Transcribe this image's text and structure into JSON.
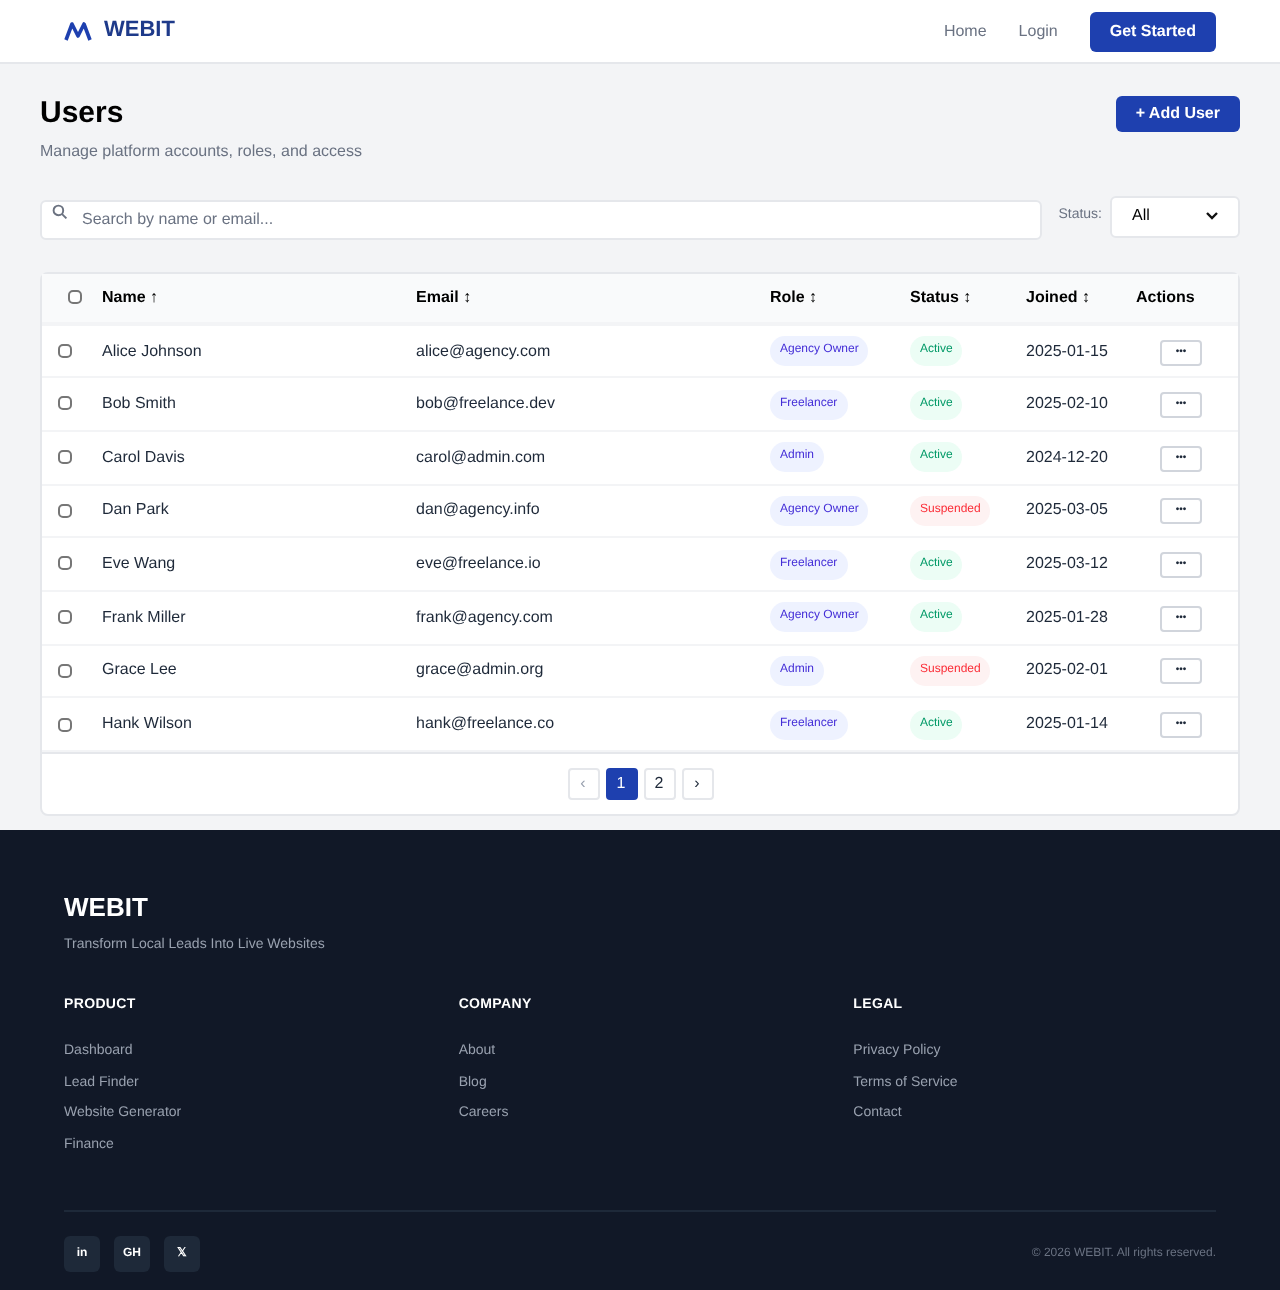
{
  "header": {
    "brand": "WEBIT",
    "nav": [
      "Home",
      "Login"
    ],
    "cta": "Get Started"
  },
  "page": {
    "title": "Users",
    "subtitle": "Manage platform accounts, roles, and access",
    "add_button": "+ Add User"
  },
  "filters": {
    "search_placeholder": "Search by name or email...",
    "status_label": "Status:",
    "status_value": "All"
  },
  "table": {
    "select_all_checked": false,
    "columns": [
      "Name ↑",
      "Email ↕",
      "Role ↕",
      "Status ↕",
      "Joined ↕",
      "Actions"
    ],
    "rows": [
      {
        "checked": false,
        "name": "Alice Johnson",
        "email": "alice@agency.com",
        "role": "Agency Owner",
        "status": "Active",
        "suspended": false,
        "joined": "2025-01-15",
        "action": "•••"
      },
      {
        "checked": false,
        "name": "Bob Smith",
        "email": "bob@freelance.dev",
        "role": "Freelancer",
        "status": "Active",
        "suspended": false,
        "joined": "2025-02-10",
        "action": "•••"
      },
      {
        "checked": false,
        "name": "Carol Davis",
        "email": "carol@admin.com",
        "role": "Admin",
        "status": "Active",
        "suspended": false,
        "joined": "2024-12-20",
        "action": "•••"
      },
      {
        "checked": false,
        "name": "Dan Park",
        "email": "dan@agency.info",
        "role": "Agency Owner",
        "status": "Suspended",
        "suspended": true,
        "joined": "2025-03-05",
        "action": "•••"
      },
      {
        "checked": false,
        "name": "Eve Wang",
        "email": "eve@freelance.io",
        "role": "Freelancer",
        "status": "Active",
        "suspended": false,
        "joined": "2025-03-12",
        "action": "•••"
      },
      {
        "checked": false,
        "name": "Frank Miller",
        "email": "frank@agency.com",
        "role": "Agency Owner",
        "status": "Active",
        "suspended": false,
        "joined": "2025-01-28",
        "action": "•••"
      },
      {
        "checked": false,
        "name": "Grace Lee",
        "email": "grace@admin.org",
        "role": "Admin",
        "status": "Suspended",
        "suspended": true,
        "joined": "2025-02-01",
        "action": "•••"
      },
      {
        "checked": false,
        "name": "Hank Wilson",
        "email": "hank@freelance.co",
        "role": "Freelancer",
        "status": "Active",
        "suspended": false,
        "joined": "2025-01-14",
        "action": "•••"
      }
    ]
  },
  "pagination": [
    {
      "label": "‹",
      "selected": false,
      "disabled": true
    },
    {
      "label": "1",
      "selected": true,
      "disabled": false
    },
    {
      "label": "2",
      "selected": false,
      "disabled": false
    },
    {
      "label": "›",
      "selected": false,
      "disabled": false
    }
  ],
  "footer": {
    "brand": "WEBIT",
    "tagline": "Transform Local Leads Into Live Websites",
    "columns": [
      {
        "heading": "PRODUCT",
        "links": [
          "Dashboard",
          "Lead Finder",
          "Website Generator",
          "Finance"
        ]
      },
      {
        "heading": "COMPANY",
        "links": [
          "About",
          "Blog",
          "Careers"
        ]
      },
      {
        "heading": "LEGAL",
        "links": [
          "Privacy Policy",
          "Terms of Service",
          "Contact"
        ]
      }
    ],
    "social": [
      "in",
      "GH",
      "𝕏"
    ],
    "copyright": "© 2026 WEBIT. All rights reserved."
  }
}
